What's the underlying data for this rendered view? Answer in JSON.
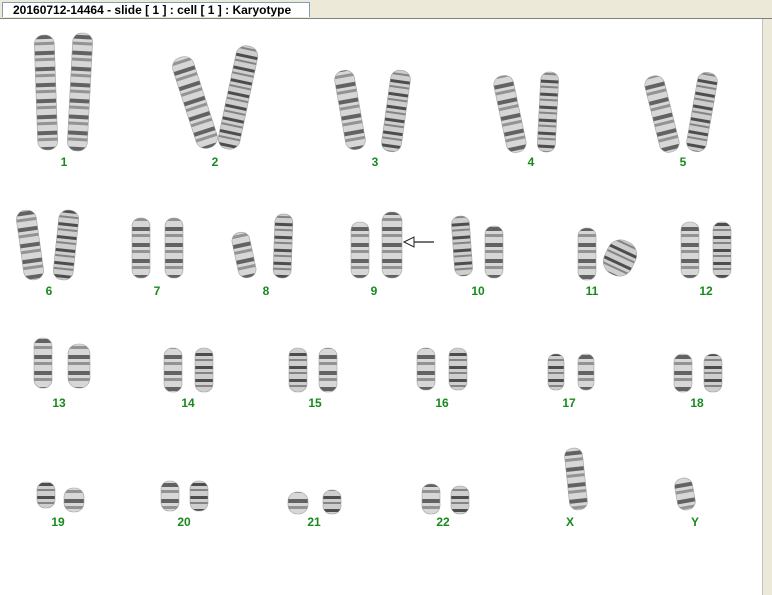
{
  "tab": {
    "title": "20160712-14464 - slide [ 1 ] : cell [ 1 ] : Karyotype"
  },
  "colors": {
    "label": "#178a1d",
    "chromosome_dark": "#2b2b2b",
    "chromosome_light": "#cfcfcf"
  },
  "karyotype": {
    "labels": [
      "1",
      "2",
      "3",
      "4",
      "5",
      "6",
      "7",
      "8",
      "9",
      "10",
      "11",
      "12",
      "13",
      "14",
      "15",
      "16",
      "17",
      "18",
      "19",
      "20",
      "21",
      "22",
      "X",
      "Y"
    ]
  }
}
